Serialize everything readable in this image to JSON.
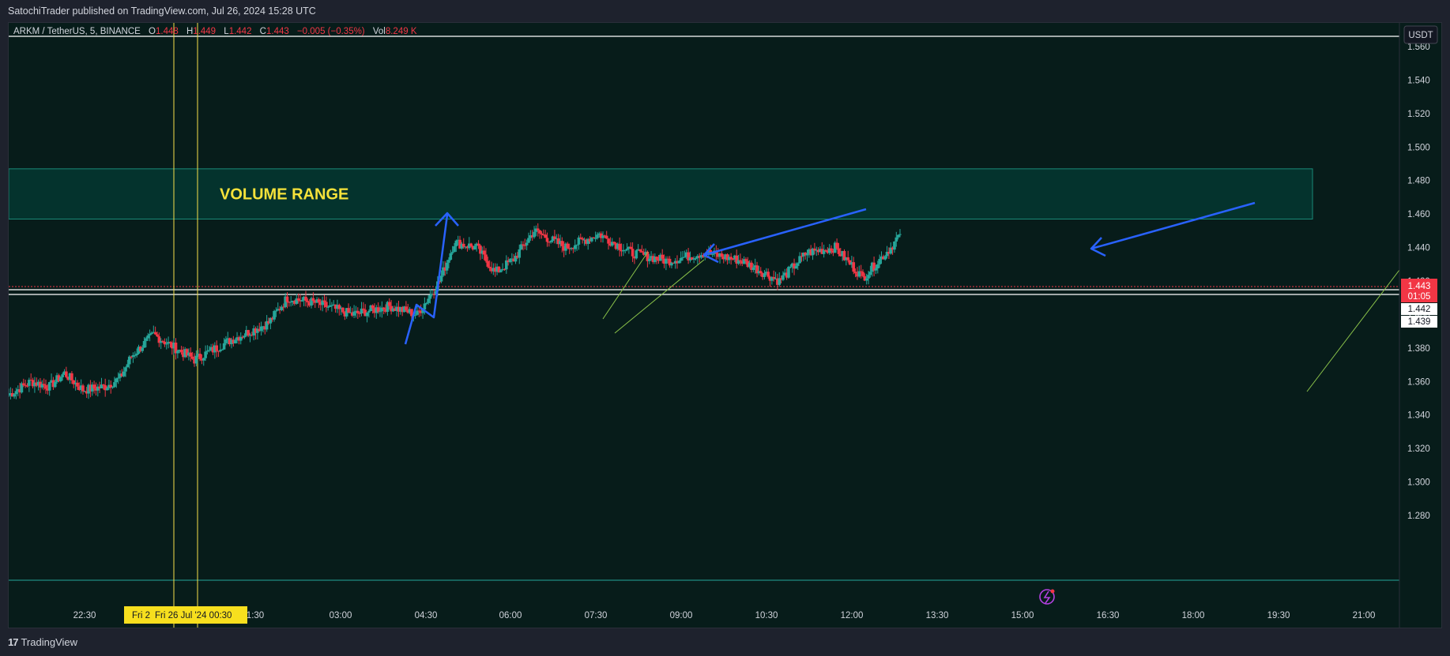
{
  "header": {
    "publisher_line": "SatochiTrader published on TradingView.com, Jul 26, 2024 15:28 UTC"
  },
  "legend": {
    "symbol": "ARKM / TetherUS, 5, BINANCE",
    "o_label": "O",
    "o_value": "1.448",
    "h_label": "H",
    "h_value": "1.449",
    "l_label": "L",
    "l_value": "1.442",
    "c_label": "C",
    "c_value": "1.443",
    "change": "−0.005 (−0.35%)",
    "vol_label": "Vol",
    "vol_value": "8.249 K"
  },
  "currency_button": "USDT",
  "price_labels": {
    "last": "1.443",
    "countdown": "01:05",
    "line1": "1.442",
    "line2": "1.439"
  },
  "annotations": {
    "zone_label": "VOLUME RANGE"
  },
  "time_highlight": {
    "label_left": "Fri 2",
    "label_main": "Fri 26 Jul '24   00:30"
  },
  "footer": {
    "brand": "TradingView"
  },
  "colors": {
    "bg": "#071c1a",
    "up": "#26a69a",
    "down": "#f23645",
    "zone_fill": "#04332d",
    "zone_border": "#1a8a78",
    "arrow": "#2962ff",
    "zone_text": "#f5e23a",
    "vline": "#f7df4b"
  },
  "chart_data": {
    "type": "candlestick",
    "y_ticks": [
      1.56,
      1.54,
      1.52,
      1.5,
      1.48,
      1.46,
      1.44,
      1.42,
      1.4,
      1.38,
      1.36,
      1.34,
      1.32,
      1.3,
      1.28
    ],
    "ylim": [
      1.28,
      1.562
    ],
    "x_ticks": [
      "22:30",
      "1:30",
      "03:00",
      "04:30",
      "06:00",
      "07:30",
      "09:00",
      "10:30",
      "12:00",
      "13:30",
      "15:00",
      "16:30",
      "18:00",
      "19:30",
      "21:00"
    ],
    "grid": false,
    "volume_range_zone": {
      "top": 1.487,
      "bottom": 1.457
    },
    "series": [
      {
        "keypoints": [
          [
            0,
            1.352
          ],
          [
            12,
            1.36
          ],
          [
            22,
            1.357
          ],
          [
            30,
            1.365
          ],
          [
            40,
            1.355
          ],
          [
            52,
            1.357
          ],
          [
            60,
            1.362
          ],
          [
            66,
            1.375
          ],
          [
            78,
            1.388
          ],
          [
            100,
            1.373
          ],
          [
            120,
            1.385
          ],
          [
            140,
            1.395
          ],
          [
            150,
            1.41
          ],
          [
            165,
            1.407
          ],
          [
            185,
            1.4
          ],
          [
            205,
            1.405
          ],
          [
            220,
            1.4
          ],
          [
            232,
            1.42
          ],
          [
            240,
            1.443
          ],
          [
            252,
            1.44
          ],
          [
            262,
            1.425
          ],
          [
            272,
            1.433
          ],
          [
            283,
            1.45
          ],
          [
            300,
            1.44
          ],
          [
            318,
            1.448
          ],
          [
            335,
            1.437
          ],
          [
            355,
            1.432
          ],
          [
            375,
            1.437
          ],
          [
            395,
            1.432
          ],
          [
            415,
            1.42
          ],
          [
            430,
            1.437
          ],
          [
            445,
            1.44
          ],
          [
            460,
            1.422
          ],
          [
            475,
            1.44
          ],
          [
            480,
            1.448
          ]
        ]
      }
    ]
  }
}
